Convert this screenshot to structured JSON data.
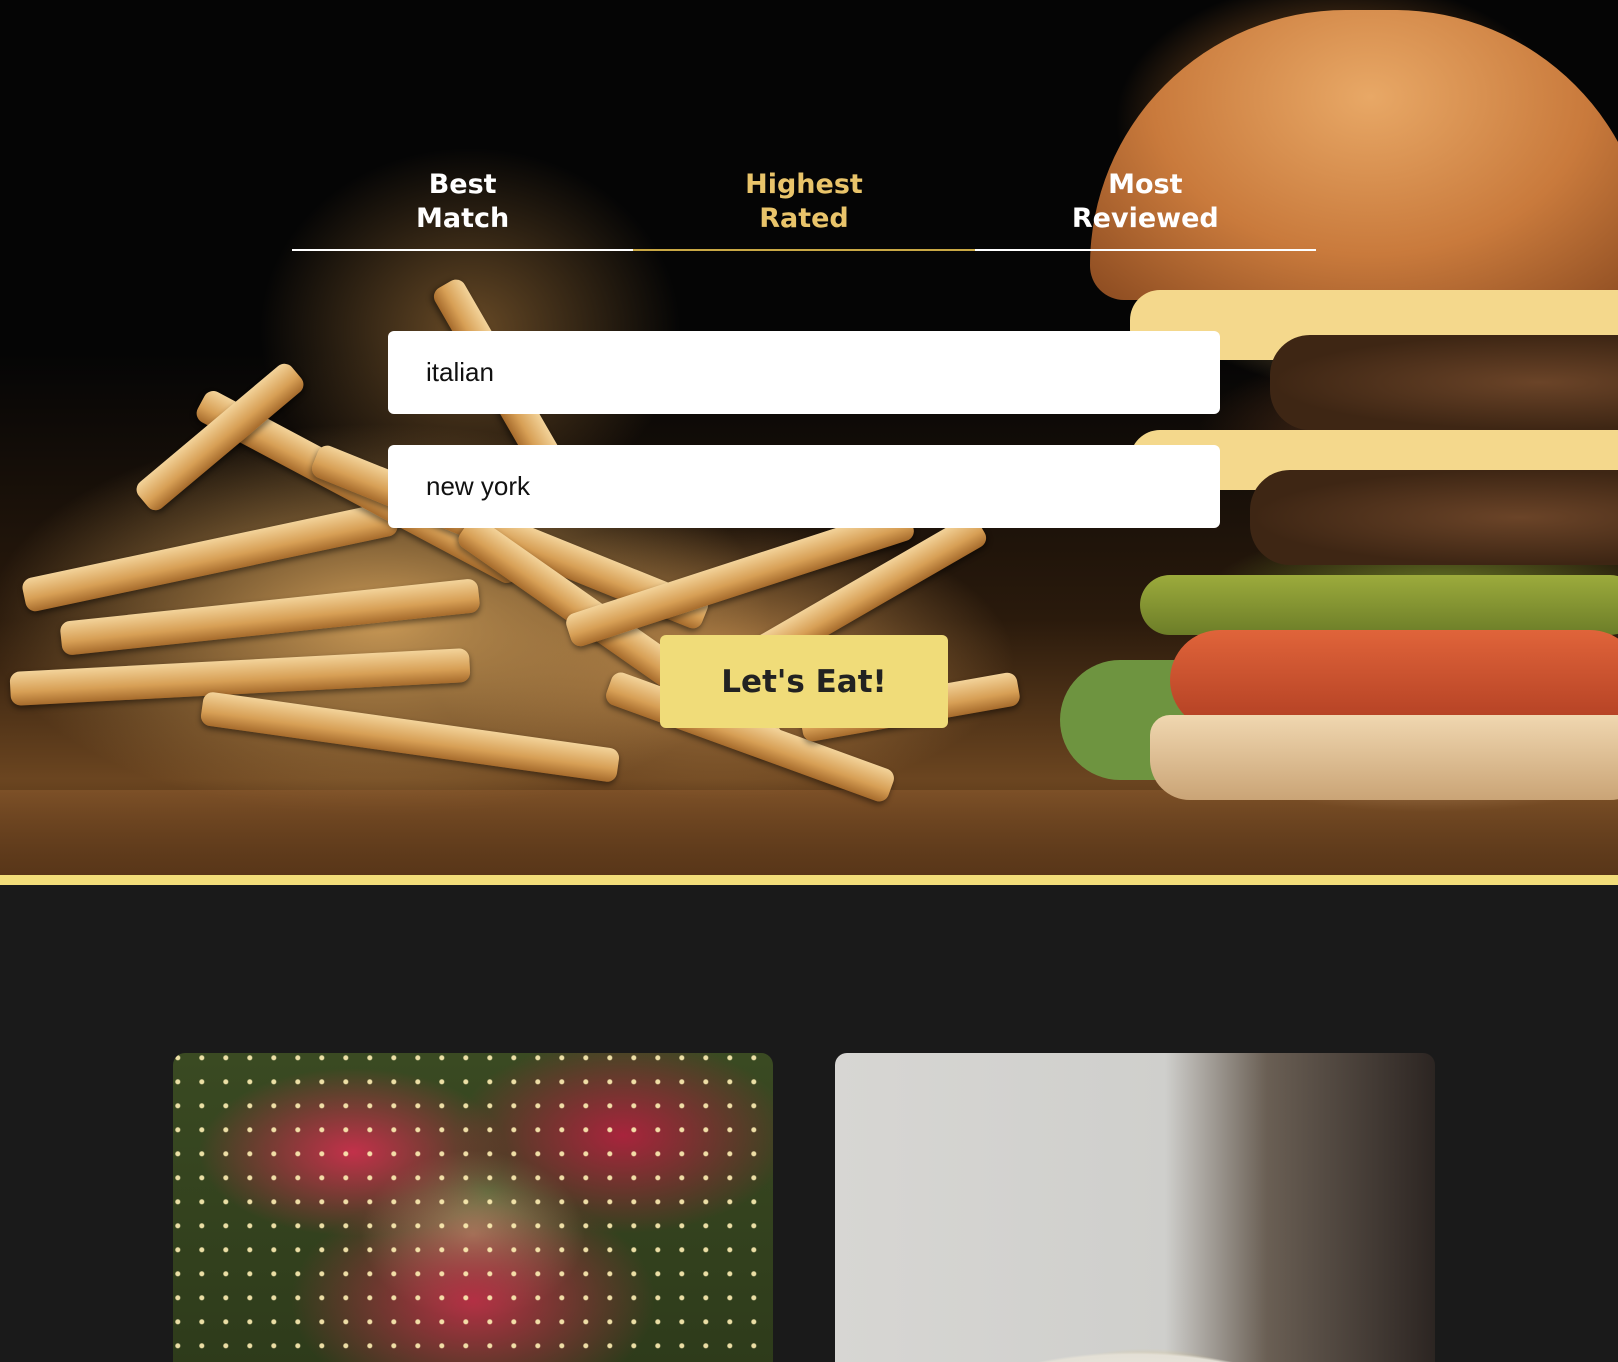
{
  "tabs": [
    {
      "label": "Best\nMatch",
      "line1": "Best",
      "line2": "Match",
      "active": false
    },
    {
      "label": "Highest\nRated",
      "line1": "Highest",
      "line2": "Rated",
      "active": true
    },
    {
      "label": "Most\nReviewed",
      "line1": "Most",
      "line2": "Reviewed",
      "active": false
    }
  ],
  "search": {
    "term_value": "italian",
    "location_value": "new york",
    "submit_label": "Let's Eat!"
  },
  "colors": {
    "accent": "#f0dc79",
    "active_tab": "#e9c46a",
    "background": "#1a1a1a"
  }
}
